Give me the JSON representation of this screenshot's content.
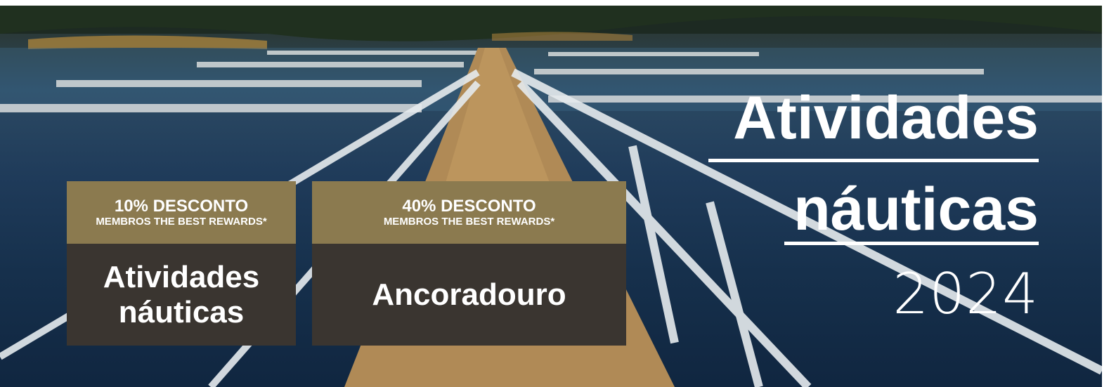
{
  "card1": {
    "discount": "10% DESCONTO",
    "members": "MEMBROS THE BEST REWARDS*",
    "title_line1": "Atividades",
    "title_line2": "náuticas"
  },
  "card2": {
    "discount": "40% DESCONTO",
    "members": "MEMBROS THE BEST REWARDS*",
    "title": "Ancoradouro"
  },
  "heading": {
    "line1": "Atividades",
    "line2": "náuticas",
    "year": "2024"
  },
  "colors": {
    "card_top": "#8b7a4f",
    "card_bottom": "#3a3530",
    "text": "#ffffff"
  }
}
